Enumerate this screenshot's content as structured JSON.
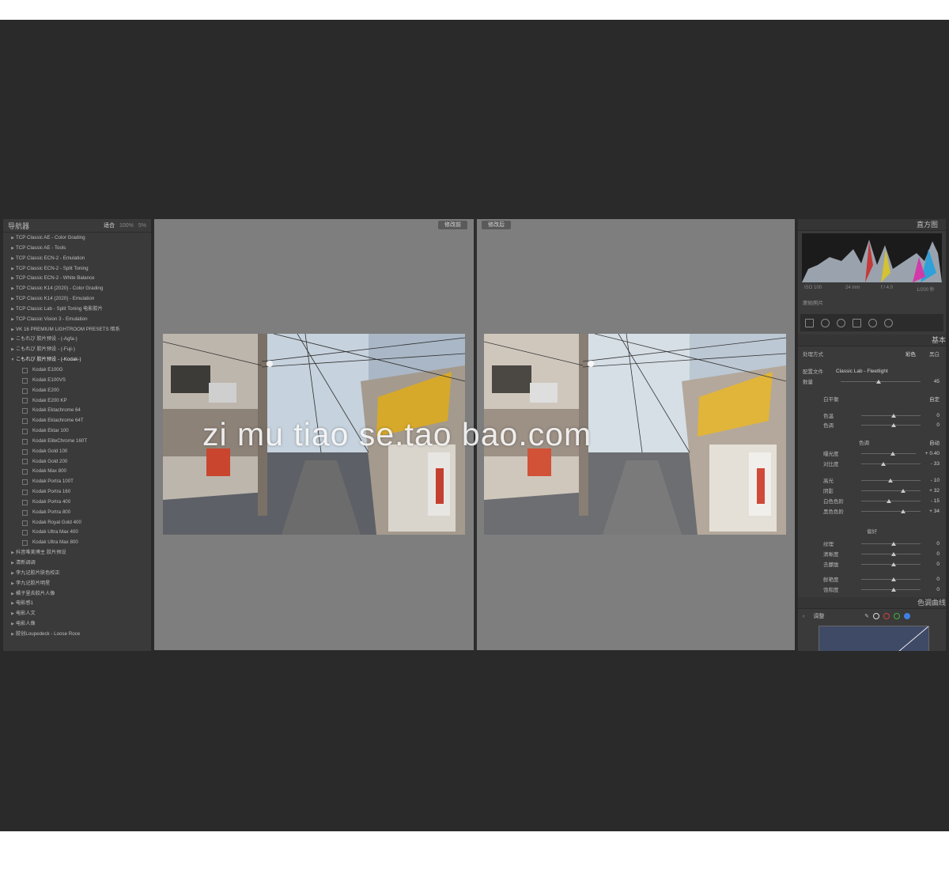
{
  "navigator": {
    "title": "导航器",
    "zoom_options": [
      "适合",
      "100%",
      "5%"
    ]
  },
  "presets": [
    {
      "label": "TCP Classic AE - Color Grading",
      "child": false
    },
    {
      "label": "TCP Classic AE - Tools",
      "child": false
    },
    {
      "label": "TCP Classic ECN-2 - Emulation",
      "child": false
    },
    {
      "label": "TCP Classic ECN-2 - Split Toning",
      "child": false
    },
    {
      "label": "TCP Classic ECN-2 - White Balance",
      "child": false
    },
    {
      "label": "TCP Classic K14 (2020) - Color Grading",
      "child": false
    },
    {
      "label": "TCP Classic K14 (2020) - Emulation",
      "child": false
    },
    {
      "label": "TCP Classic Lab - Split Toning 电影胶片",
      "child": false
    },
    {
      "label": "TCP Classic Vision 3 - Emulation",
      "child": false
    },
    {
      "label": "VK 16 PREMIUM LIGHTROOM PRESETS 暗系",
      "child": false
    },
    {
      "label": "こもれび 胶片预设 - (-Agfa-)",
      "child": false
    },
    {
      "label": "こもれび 胶片预设 - (-Fuji-)",
      "child": false
    },
    {
      "label": "こもれび 胶片预设 - (-Kodak-)",
      "child": false,
      "open": true
    },
    {
      "label": "Kodak E100G",
      "child": true
    },
    {
      "label": "Kodak E100VS",
      "child": true
    },
    {
      "label": "Kodak E200",
      "child": true
    },
    {
      "label": "Kodak E200 KP",
      "child": true
    },
    {
      "label": "Kodak Ektachrome 64",
      "child": true
    },
    {
      "label": "Kodak Ektachrome 64T",
      "child": true
    },
    {
      "label": "Kodak Ektar 100",
      "child": true
    },
    {
      "label": "Kodak EliteChrome 160T",
      "child": true
    },
    {
      "label": "Kodak Gold 100",
      "child": true
    },
    {
      "label": "Kodak Gold 200",
      "child": true
    },
    {
      "label": "Kodak Max 800",
      "child": true
    },
    {
      "label": "Kodak Portra 100T",
      "child": true
    },
    {
      "label": "Kodak Portra 160",
      "child": true
    },
    {
      "label": "Kodak Portra 400",
      "child": true
    },
    {
      "label": "Kodak Portra 800",
      "child": true
    },
    {
      "label": "Kodak Royal Gold 400",
      "child": true
    },
    {
      "label": "Kodak Ultra Max 400",
      "child": true
    },
    {
      "label": "Kodak Ultra Max 800",
      "child": true
    },
    {
      "label": "抖音唯美博主 胶片预设",
      "child": false
    },
    {
      "label": "清新调调",
      "child": false
    },
    {
      "label": "李九记胶片肤色校正",
      "child": false
    },
    {
      "label": "李九记胶片明星",
      "child": false
    },
    {
      "label": "橘子里去胶片人像",
      "child": false
    },
    {
      "label": "电影感1",
      "child": false
    },
    {
      "label": "电影人文",
      "child": false
    },
    {
      "label": "电影人像",
      "child": false
    },
    {
      "label": "胶创Loupedeck - Loose Roce",
      "child": false
    }
  ],
  "compare": {
    "before_label": "修改前",
    "after_label": "修改后"
  },
  "watermark": "zi mu tiao se.tao bao.com",
  "right_panel": {
    "histogram_title": "直方图",
    "histogram_info": [
      "ISO 100",
      "24 mm",
      "f / 4.0",
      "1/200 秒"
    ],
    "original_photo": "原始照片",
    "basic_title": "基本",
    "treatment": {
      "label": "处理方式",
      "color": "彩色",
      "bw": "黑白"
    },
    "profile": {
      "label": "配置文件",
      "value": "Classic Lab - Fleetlight"
    },
    "amount": {
      "label": "数量",
      "value": "45"
    },
    "wb": {
      "label": "白平衡",
      "value": "自定"
    },
    "temp": {
      "label": "色温",
      "value": "0"
    },
    "tint": {
      "label": "色调",
      "value": "0"
    },
    "tone_title": "色调",
    "tone_auto": "自动",
    "exposure": {
      "label": "曝光度",
      "value": "+ 0.40"
    },
    "contrast": {
      "label": "对比度",
      "value": "- 33"
    },
    "highlights": {
      "label": "高光",
      "value": "- 10"
    },
    "shadows": {
      "label": "阴影",
      "value": "+ 32"
    },
    "whites": {
      "label": "白色色阶",
      "value": "- 15"
    },
    "blacks": {
      "label": "黑色色阶",
      "value": "+ 34"
    },
    "presence_title": "偏好",
    "texture": {
      "label": "纹理",
      "value": "0"
    },
    "clarity": {
      "label": "清晰度",
      "value": "0"
    },
    "dehaze": {
      "label": "去朦胧",
      "value": "0"
    },
    "vibrance": {
      "label": "鲜艳度",
      "value": "0"
    },
    "saturation": {
      "label": "饱和度",
      "value": "0"
    },
    "curve_title": "色调曲线",
    "curve_adjust": "调整"
  }
}
